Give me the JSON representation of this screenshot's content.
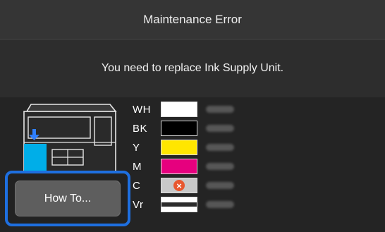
{
  "header": {
    "title": "Maintenance Error"
  },
  "message": {
    "text": "You need to replace Ink Supply Unit."
  },
  "button": {
    "label": "How To..."
  },
  "inks": [
    {
      "code": "WH",
      "color": "#ffffff",
      "status": "ok"
    },
    {
      "code": "BK",
      "color": "#000000",
      "status": "ok"
    },
    {
      "code": "Y",
      "color": "#ffe600",
      "status": "ok"
    },
    {
      "code": "M",
      "color": "#e6007e",
      "status": "ok"
    },
    {
      "code": "C",
      "color": "#c8c8c8",
      "status": "error"
    },
    {
      "code": "Vr",
      "color": "#ffffff",
      "status": "ok"
    }
  ],
  "colors": {
    "accent_blue": "#1e6fe0",
    "slot_cyan": "#00aee8",
    "error_orange": "#e8572f"
  },
  "icons": {
    "error": "error-x-icon",
    "slot_arrow": "arrow-down-icon"
  }
}
